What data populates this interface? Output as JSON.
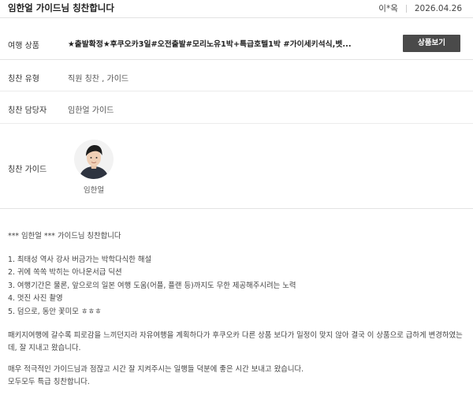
{
  "header": {
    "title": "임한얼 가이드님 칭찬합니다",
    "author": "이*옥",
    "date": "2026.04.26"
  },
  "product": {
    "label": "여행 상품",
    "value": "★출발확정★후쿠오카3일#오전출발#모리노유1박+특급호텔1박 #가이세키석식,벳...",
    "button_label": "상품보기"
  },
  "praise_type": {
    "label": "칭찬 유형",
    "value": "직원 칭찬 , 가이드"
  },
  "praise_target": {
    "label": "칭찬 담당자",
    "value": "임한얼 가이드"
  },
  "praise_guide": {
    "label": "칭찬 가이드",
    "name": "임한얼"
  },
  "content": {
    "intro": "*** 임한얼 *** 가이드님 칭찬합니다",
    "items": [
      "1. 최태성 역사 강사 버금가는 박학다식한 해설",
      "2. 귀에 쏙쏙 박히는 아나운서급 딕션",
      "3. 여행기간은 물론, 앞으로의 일본 여행 도움(어플, 플랜 등)까지도 무한 제공해주시려는 노력",
      "4. 멋진 사진 촬영",
      "5. 덤으로, 동안 꽃미모 ㅎㅎㅎ"
    ],
    "paragraph1": "패키지여행에 갈수록 피로감을 느끼던지라 자유여행을 계획하다가 후쿠오카 다른 상품 보다가 일정이 맞지 않아 결국 이 상품으로 급하게 변경하였는데, 잘 지내고 왔습니다.",
    "paragraph2_line1": "매우 적극적인 가이드님과 점잖고 시간 잘 지켜주시는 일행들 덕분에 좋은 시간 보내고 왔습니다.",
    "paragraph2_line2": "모두모두 특급 칭찬합니다."
  },
  "colors": {
    "button_bg": "#4a4a4a",
    "divider": "#e3e3e3"
  }
}
